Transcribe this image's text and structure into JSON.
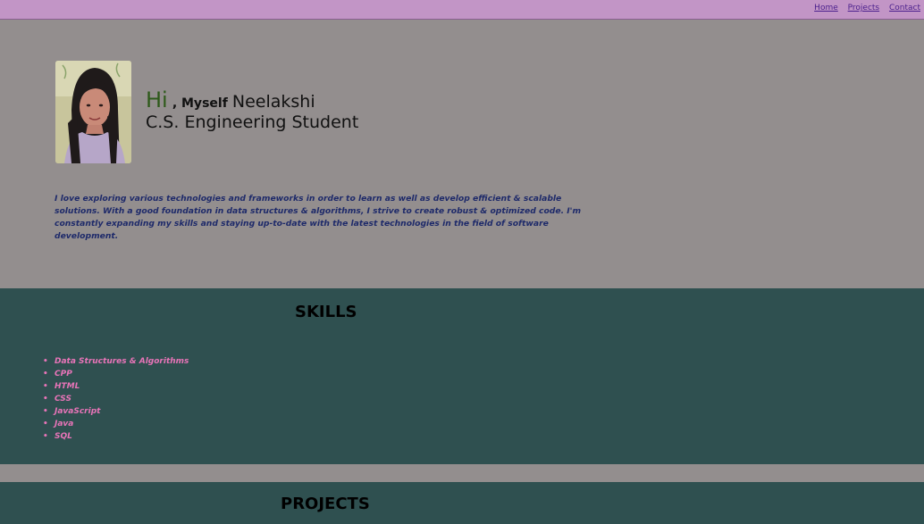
{
  "nav": {
    "items": [
      "Home",
      "Projects",
      "Contact"
    ]
  },
  "hero": {
    "greeting": "Hi",
    "myself": ", Myself",
    "name": "Neelakshi",
    "role": "C.S. Engineering Student",
    "about": "I love exploring various technologies and frameworks in order to learn as well as develop efficient & scalable solutions. With a good foundation in data structures & algorithms, I strive to create robust & optimized code. I'm constantly expanding my skills and staying up-to-date with the latest technologies in the field of software development."
  },
  "skills": {
    "title": "SKILLS",
    "items": [
      "Data Structures & Algorithms",
      "CPP",
      "HTML",
      "CSS",
      "JavaScript",
      "Java",
      "SQL"
    ]
  },
  "projects": {
    "title": "PROJECTS"
  },
  "colors": {
    "topbar": "#c295c6",
    "hero_bg": "#938e8e",
    "section_bg": "#2f5050",
    "greeting": "#2d5a1a",
    "about_text": "#1e2a6a",
    "skill_text": "#e874b8",
    "nav_link": "#4a1f8c"
  }
}
